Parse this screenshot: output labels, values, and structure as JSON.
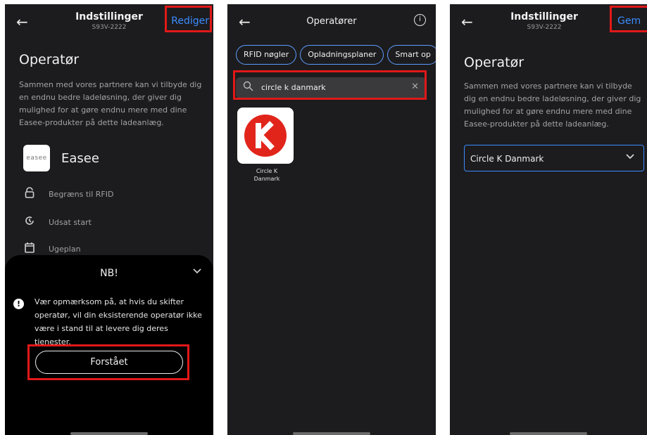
{
  "screen1": {
    "header_title": "Indstillinger",
    "header_subtitle": "S93V-2222",
    "action_label": "Rediger",
    "section_title": "Operatør",
    "description": "Sammen med vores partnere kan vi tilbyde dig en endnu bedre ladeløsning, der giver dig mulighed for at gøre endnu mere med dine Easee-produkter på dette ladeanlæg.",
    "logo_text": "easee",
    "operator_name": "Easee",
    "features": [
      {
        "label": "Begræns til RFID",
        "icon": "rfid-lock-icon"
      },
      {
        "label": "Udsat start",
        "icon": "delayed-start-icon"
      },
      {
        "label": "Ugeplan",
        "icon": "calendar-icon"
      }
    ],
    "sheet": {
      "title": "NB!",
      "warning": "Vær opmærksom på, at hvis du skifter operatør, vil din eksisterende operatør ikke være i stand til at levere dig deres tjenester.",
      "button_label": "Forstået"
    }
  },
  "screen2": {
    "header_title": "Operatører",
    "chips": [
      "RFID nøgler",
      "Opladningsplaner",
      "Smart op"
    ],
    "search_value": "circle k danmark",
    "result": {
      "name_line1": "Circle K",
      "name_line2": "Danmark"
    }
  },
  "screen3": {
    "header_title": "Indstillinger",
    "header_subtitle": "S93V-2222",
    "action_label": "Gem",
    "section_title": "Operatør",
    "description": "Sammen med vores partnere kan vi tilbyde dig en endnu bedre ladeløsning, der giver dig mulighed for at gøre endnu mere med dine Easee-produkter på dette ladeanlæg.",
    "selected_operator": "Circle K Danmark"
  },
  "colors": {
    "accent": "#3b8cff",
    "highlight": "#e11818",
    "background": "#1c1c1e",
    "circle_k_red": "#e1251b"
  }
}
